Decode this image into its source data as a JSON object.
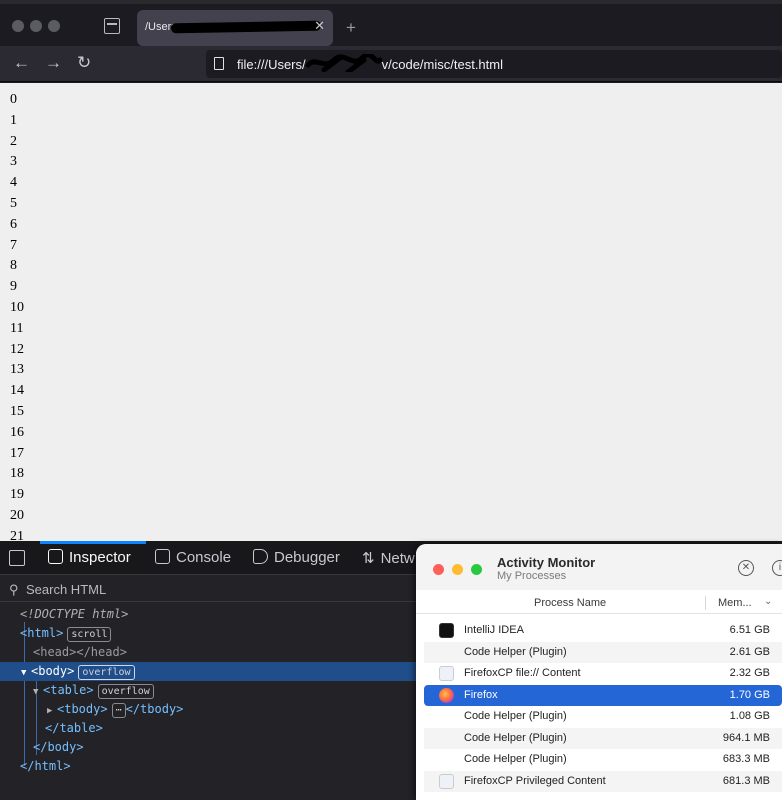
{
  "browser": {
    "tab_title": "/Users,",
    "url": "file:///Users/",
    "url_suffix": "v/code/misc/test.html"
  },
  "page": {
    "rows": [
      "0",
      "1",
      "2",
      "3",
      "4",
      "5",
      "6",
      "7",
      "8",
      "9",
      "10",
      "11",
      "12",
      "13",
      "14",
      "15",
      "16",
      "17",
      "18",
      "19",
      "20",
      "21"
    ]
  },
  "devtools": {
    "tabs": [
      {
        "label": "Inspector",
        "icon": "inspector-icon"
      },
      {
        "label": "Console",
        "icon": "console-icon"
      },
      {
        "label": "Debugger",
        "icon": "debugger-icon"
      },
      {
        "label": "Netw",
        "icon": "network-icon"
      }
    ],
    "search_placeholder": "Search HTML",
    "tree": {
      "doctype": "<!DOCTYPE html>",
      "html_open": "<html>",
      "html_badge": "scroll",
      "head": "<head></head>",
      "body_open": "<body>",
      "body_badge": "overflow",
      "table_open": "<table>",
      "table_badge": "overflow",
      "tbody_open": "<tbody>",
      "tbody_ellipsis": "⋯",
      "tbody_close": "</tbody>",
      "table_close": "</table>",
      "body_close": "</body>",
      "html_close": "</html>"
    }
  },
  "activity_monitor": {
    "title": "Activity Monitor",
    "subtitle": "My Processes",
    "col_name": "Process Name",
    "col_mem": "Mem...",
    "processes": [
      {
        "name": "IntelliJ IDEA",
        "mem": "6.51 GB",
        "icon": "intellij-icon"
      },
      {
        "name": "Code Helper (Plugin)",
        "mem": "2.61 GB",
        "icon": ""
      },
      {
        "name": "FirefoxCP file:// Content",
        "mem": "2.32 GB",
        "icon": "document-icon"
      },
      {
        "name": "Firefox",
        "mem": "1.70 GB",
        "icon": "firefox-icon"
      },
      {
        "name": "Code Helper (Plugin)",
        "mem": "1.08 GB",
        "icon": ""
      },
      {
        "name": "Code Helper (Plugin)",
        "mem": "964.1 MB",
        "icon": ""
      },
      {
        "name": "Code Helper (Plugin)",
        "mem": "683.3 MB",
        "icon": ""
      },
      {
        "name": "FirefoxCP Privileged Content",
        "mem": "681.3 MB",
        "icon": "document-icon"
      }
    ]
  },
  "colors": {
    "selection_blue": "#2466d6",
    "devtools_accent": "#0a84ff",
    "tree_selection": "#204e8a"
  }
}
